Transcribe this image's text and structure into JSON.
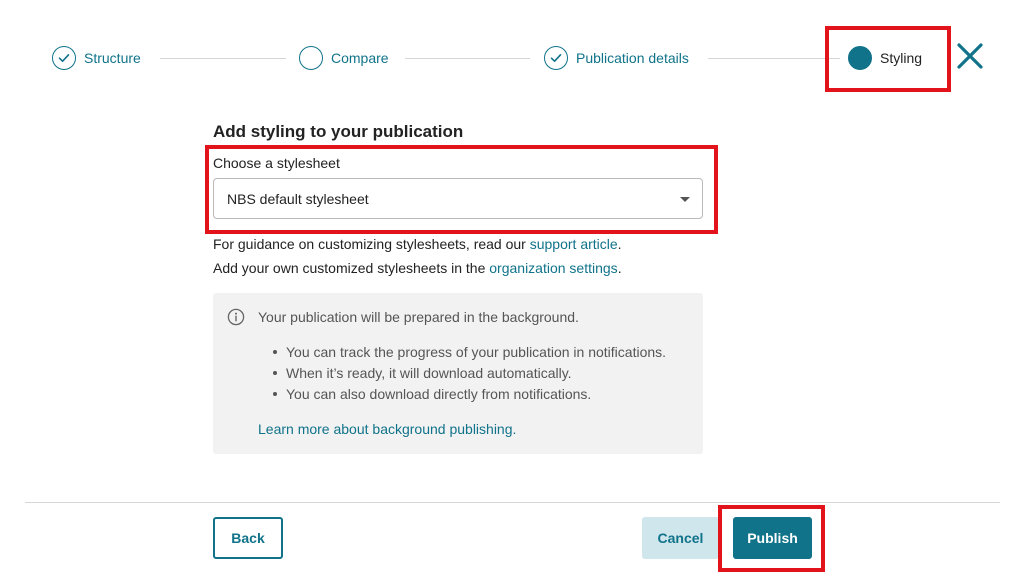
{
  "stepper": {
    "steps": [
      {
        "label": "Structure",
        "state": "complete"
      },
      {
        "label": "Compare",
        "state": "incomplete"
      },
      {
        "label": "Publication details",
        "state": "complete"
      },
      {
        "label": "Styling",
        "state": "current"
      }
    ],
    "close_icon": "close-icon"
  },
  "main": {
    "heading": "Add styling to your publication",
    "stylesheet": {
      "label": "Choose a stylesheet",
      "selected_value": "NBS default stylesheet"
    },
    "guidance": {
      "prefix": "For guidance on customizing stylesheets, read our ",
      "link": "support article",
      "suffix": "."
    },
    "custom": {
      "prefix": "Add your own customized stylesheets in the ",
      "link": "organization settings",
      "suffix": "."
    },
    "info": {
      "icon": "info-icon",
      "title": "Your publication will be prepared in the background.",
      "bullets": [
        "You can track the progress of your publication in notifications.",
        "When it’s ready, it will download automatically.",
        "You can also download directly from notifications."
      ],
      "link": "Learn more about background publishing",
      "link_suffix": "."
    }
  },
  "footer": {
    "back_label": "Back",
    "cancel_label": "Cancel",
    "publish_label": "Publish"
  },
  "colors": {
    "accent": "#10738a",
    "highlight": "#e3131c",
    "cancel_bg": "#cfe6ec",
    "info_bg": "#f2f2f2"
  }
}
